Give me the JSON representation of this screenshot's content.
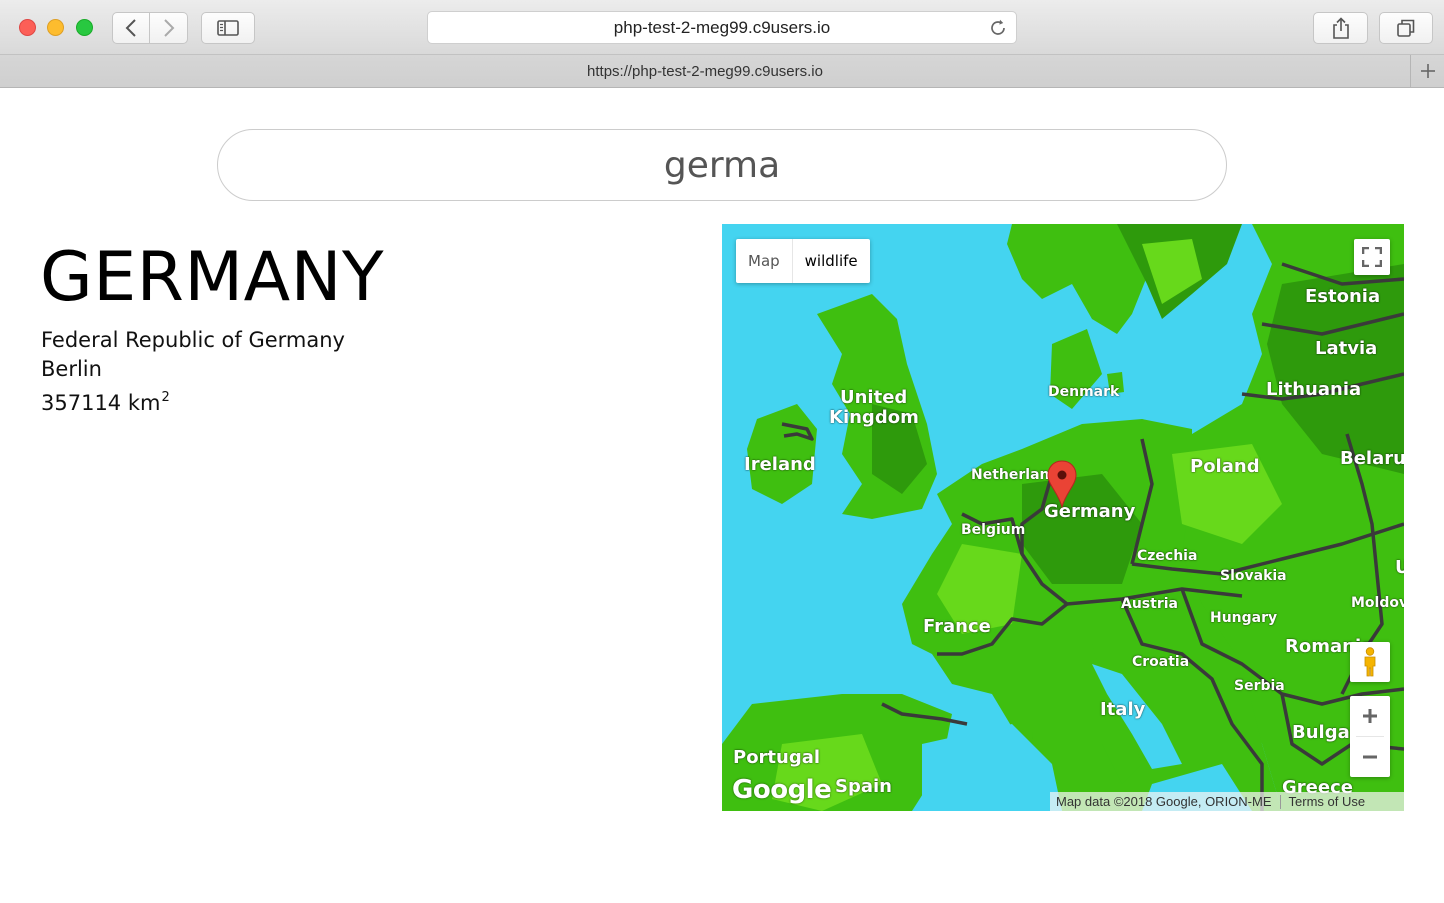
{
  "browser": {
    "address": "php-test-2-meg99.c9users.io",
    "tab_title": "https://php-test-2-meg99.c9users.io"
  },
  "search": {
    "value": "germa"
  },
  "country": {
    "name": "GERMANY",
    "official_name": "Federal Republic of Germany",
    "capital": "Berlin",
    "area_value": "357114 km",
    "area_sup": "2"
  },
  "map": {
    "type_options": [
      "Map",
      "wildlife"
    ],
    "selected_type": "wildlife",
    "labels": {
      "estonia": "Estonia",
      "latvia": "Latvia",
      "lithuania": "Lithuania",
      "denmark": "Denmark",
      "united_kingdom_1": "United",
      "united_kingdom_2": "Kingdom",
      "ireland": "Ireland",
      "netherlands": "Netherlands",
      "germany": "Germany",
      "poland": "Poland",
      "belarus": "Belarus",
      "belgium": "Belgium",
      "czechia": "Czechia",
      "slovakia": "Slovakia",
      "austria": "Austria",
      "hungary": "Hungary",
      "moldova": "Moldova",
      "france": "France",
      "romania": "Romania",
      "croatia": "Croatia",
      "serbia": "Serbia",
      "italy": "Italy",
      "bulgaria": "Bulgaria",
      "portugal": "Portugal",
      "spain": "Spain",
      "greece": "Greece",
      "ukraine_fragment": "U"
    },
    "logo": "Google",
    "attribution": "Map data ©2018 Google, ORION-ME",
    "terms": "Terms of Use",
    "colors": {
      "water": "#44d4f0",
      "land": "#3fbf10",
      "land_light": "#67d91b",
      "land_dark": "#2e9a0c",
      "borders": "#3a3a3a",
      "marker": "#ea4335"
    }
  }
}
